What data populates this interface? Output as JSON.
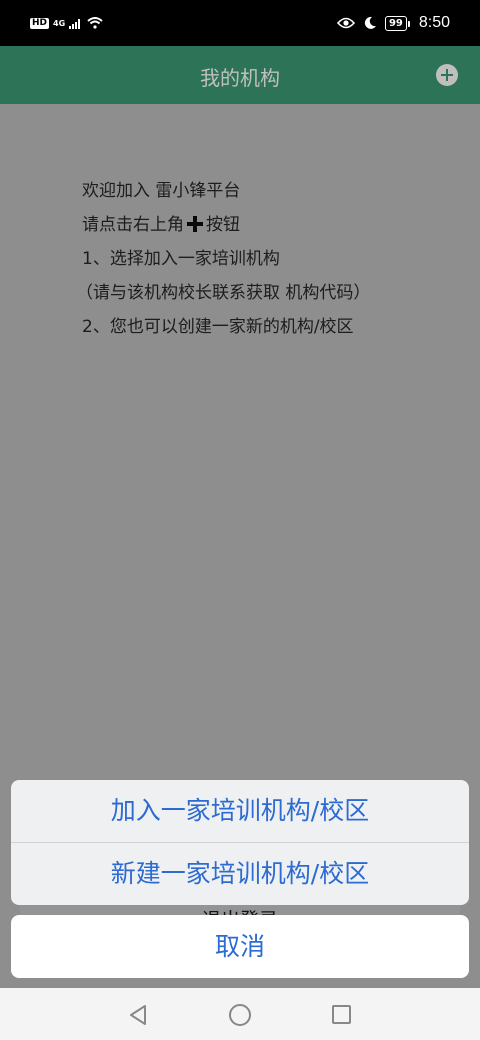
{
  "status_bar": {
    "hd": "HD",
    "network": "4G",
    "battery": "99",
    "time": "8:50"
  },
  "header": {
    "title": "我的机构",
    "add_icon": "plus-circle-icon"
  },
  "welcome": {
    "line1": "欢迎加入 雷小锋平台",
    "line2_prefix": "请点击右上角",
    "line2_suffix": "按钮",
    "line3": "1、选择加入一家培训机构",
    "line4": "（请与该机构校长联系获取 机构代码）",
    "line5": "2、您也可以创建一家新的机构/校区"
  },
  "underlay": {
    "label": "退出登录"
  },
  "action_sheet": {
    "options": [
      "加入一家培训机构/校区",
      "新建一家培训机构/校区"
    ],
    "cancel": "取消"
  },
  "colors": {
    "header": "#3d9a74",
    "action_text": "#2c6bd1"
  }
}
